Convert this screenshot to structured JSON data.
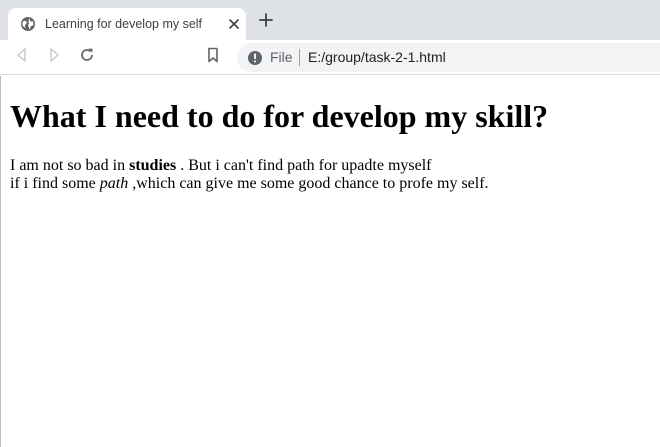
{
  "tab": {
    "title": "Learning for develop my self",
    "favicon": "globe-icon",
    "close_icon": "close-icon"
  },
  "newtab_icon": "plus-icon",
  "toolbar": {
    "back_icon": "back-arrow-icon",
    "forward_icon": "forward-arrow-icon",
    "reload_icon": "reload-icon",
    "bookmark_icon": "bookmark-icon"
  },
  "omnibox": {
    "info_icon": "info-icon",
    "site_label": "File",
    "url": "E:/group/task-2-1.html"
  },
  "page": {
    "heading": "What I need to do for develop my skill?",
    "line1_before": "I am not so bad in ",
    "line1_bold": "studies",
    "line1_after": " . But i can't find path for upadte myself",
    "line2_before": "if i find some ",
    "line2_italic": "path",
    "line2_after": " ,which can give me some good chance to profe my self."
  },
  "colors": {
    "tabstrip_bg": "#dee1e6",
    "omnibox_bg": "#f1f3f4",
    "icon_gray": "#5f6368",
    "text_dark": "#202124"
  }
}
